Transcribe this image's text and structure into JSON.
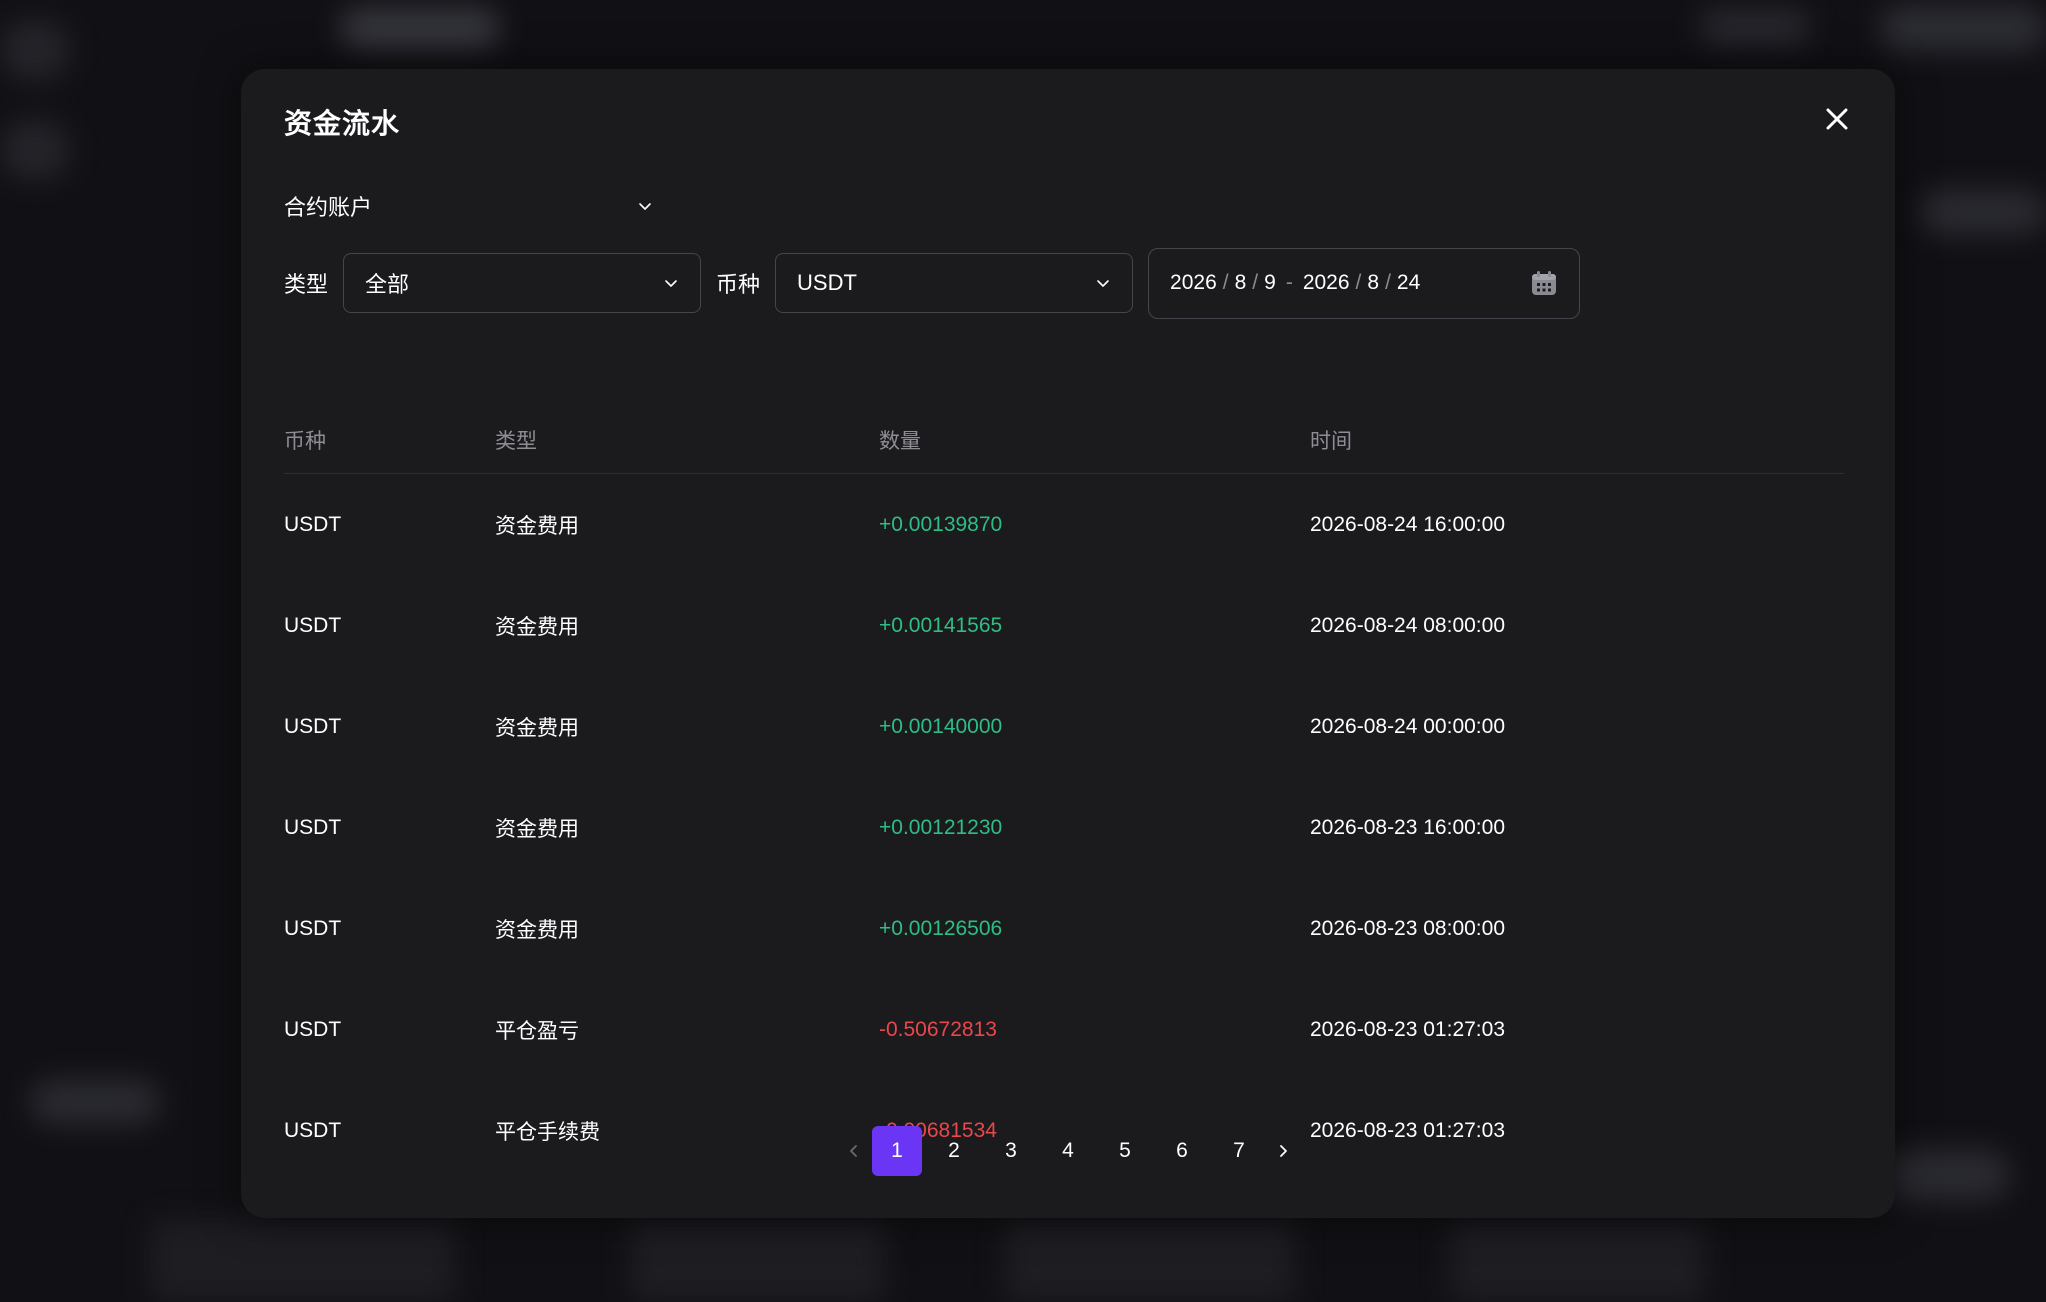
{
  "modal": {
    "title": "资金流水"
  },
  "account": {
    "selected": "合约账户"
  },
  "filters": {
    "type_label": "类型",
    "type_value": "全部",
    "coin_label": "币种",
    "coin_value": "USDT",
    "date_start": {
      "year": "2026",
      "month": "8",
      "day": "9"
    },
    "date_end": {
      "year": "2026",
      "month": "8",
      "day": "24"
    },
    "date_sep": "/",
    "date_dash": "-"
  },
  "table": {
    "headers": {
      "coin": "币种",
      "type": "类型",
      "amount": "数量",
      "time": "时间"
    },
    "rows": [
      {
        "coin": "USDT",
        "type": "资金费用",
        "amount": "+0.00139870",
        "sign": "pos",
        "time": "2026-08-24 16:00:00"
      },
      {
        "coin": "USDT",
        "type": "资金费用",
        "amount": "+0.00141565",
        "sign": "pos",
        "time": "2026-08-24 08:00:00"
      },
      {
        "coin": "USDT",
        "type": "资金费用",
        "amount": "+0.00140000",
        "sign": "pos",
        "time": "2026-08-24 00:00:00"
      },
      {
        "coin": "USDT",
        "type": "资金费用",
        "amount": "+0.00121230",
        "sign": "pos",
        "time": "2026-08-23 16:00:00"
      },
      {
        "coin": "USDT",
        "type": "资金费用",
        "amount": "+0.00126506",
        "sign": "pos",
        "time": "2026-08-23 08:00:00"
      },
      {
        "coin": "USDT",
        "type": "平仓盈亏",
        "amount": "-0.50672813",
        "sign": "neg",
        "time": "2026-08-23 01:27:03"
      },
      {
        "coin": "USDT",
        "type": "平仓手续费",
        "amount": "-0.00681534",
        "sign": "neg",
        "time": "2026-08-23 01:27:03"
      }
    ]
  },
  "pagination": {
    "pages": [
      "1",
      "2",
      "3",
      "4",
      "5",
      "6",
      "7"
    ],
    "current": "1"
  },
  "colors": {
    "positive": "#2ebd85",
    "negative": "#e8474b",
    "accent": "#6b35f5"
  },
  "icons": {
    "close": "close-icon",
    "chevron": "chevron-down-icon",
    "calendar": "calendar-icon",
    "prev": "chevron-left-icon",
    "next": "chevron-right-icon"
  }
}
